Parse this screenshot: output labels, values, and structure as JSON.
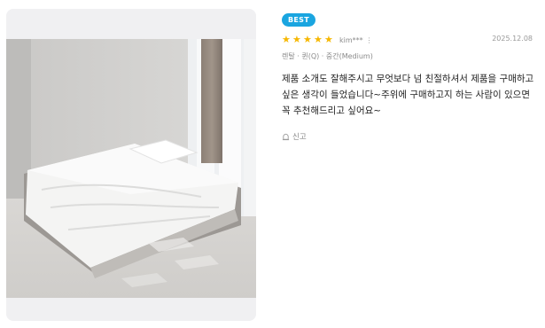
{
  "badge": {
    "label": "BEST",
    "color": "#1aa5e0"
  },
  "rating": {
    "stars": 5,
    "max": 5,
    "color": "#f6b700"
  },
  "reviewer": {
    "name": "kim***",
    "more_icon": "more-vertical-icon"
  },
  "date": "2025.12.08",
  "option": "렌탈 · 퀸(Q) · 중간(Medium)",
  "review_text": "제품 소개도 잘해주시고 무엇보다 넘 친절하셔서 제품을 구매하고 싶은 생각이 들었습니다~주위에 구매하고지 하는 사람이 있으면 꼭 추천해드리고 싶어요~",
  "report": {
    "label": "신고",
    "icon": "report-icon"
  },
  "photo": {
    "icon": "review-photo"
  }
}
